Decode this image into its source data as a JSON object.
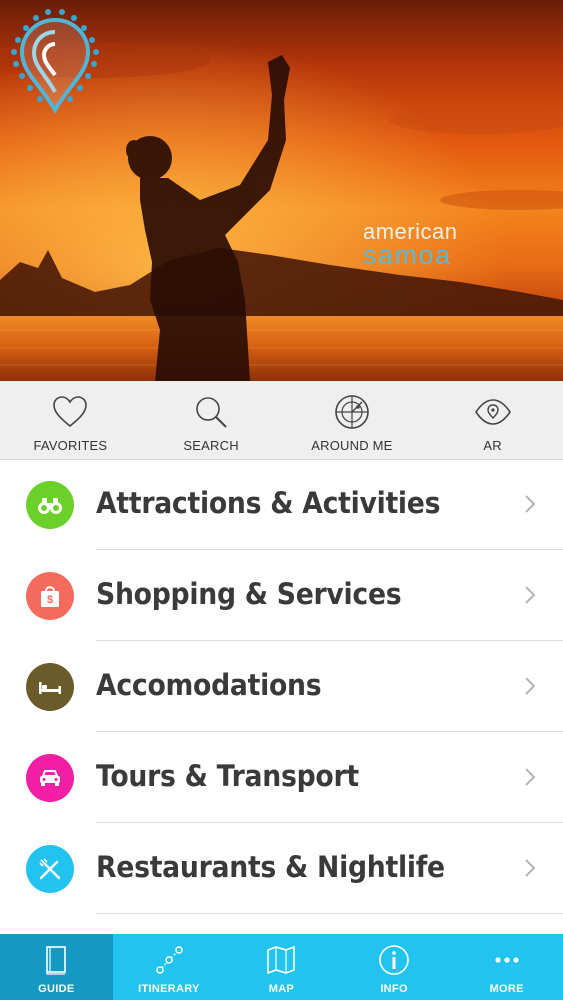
{
  "hero": {
    "logo_line1": "american",
    "logo_line2": "samoa"
  },
  "quickbar": {
    "items": [
      {
        "label": "FAVORITES",
        "icon": "heart-icon"
      },
      {
        "label": "SEARCH",
        "icon": "search-icon"
      },
      {
        "label": "AROUND ME",
        "icon": "radar-icon"
      },
      {
        "label": "AR",
        "icon": "eye-icon"
      }
    ]
  },
  "categories": [
    {
      "label": "Attractions & Activities",
      "icon": "binoculars-icon",
      "color": "#6ad12a"
    },
    {
      "label": "Shopping & Services",
      "icon": "shopping-bag-icon",
      "color": "#f46b5e"
    },
    {
      "label": "Accomodations",
      "icon": "bed-icon",
      "color": "#6b5a2a"
    },
    {
      "label": "Tours & Transport",
      "icon": "car-icon",
      "color": "#f21fa4"
    },
    {
      "label": "Restaurants & Nightlife",
      "icon": "utensils-icon",
      "color": "#22c4ef"
    }
  ],
  "tabbar": {
    "items": [
      {
        "label": "GUIDE",
        "icon": "book-icon",
        "active": true
      },
      {
        "label": "ITINERARY",
        "icon": "route-icon",
        "active": false
      },
      {
        "label": "MAP",
        "icon": "map-icon",
        "active": false
      },
      {
        "label": "INFO",
        "icon": "info-icon",
        "active": false
      },
      {
        "label": "MORE",
        "icon": "more-icon",
        "active": false
      }
    ]
  },
  "colors": {
    "tab_bar": "#22c4ef",
    "tab_active": "#1499c4",
    "quickbar_bg": "#efeff0",
    "logo_accent": "#5ab8d8"
  }
}
